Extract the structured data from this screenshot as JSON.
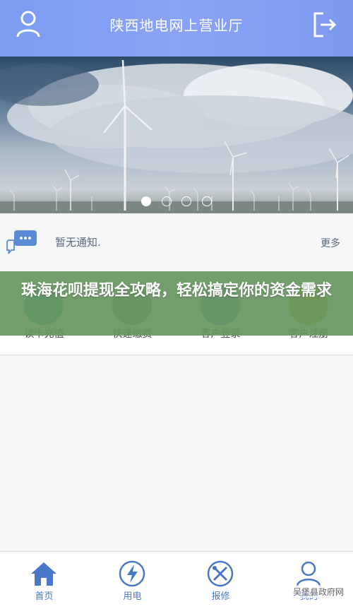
{
  "header": {
    "title": "陕西地电网上营业厅",
    "user_icon": "user-icon",
    "logout_icon": "logout-icon"
  },
  "banner": {
    "slide_count": 4,
    "active_slide": 1
  },
  "notice": {
    "icon": "chat-bubble-icon",
    "text": "暂无通知.",
    "more_label": "更多"
  },
  "menu": {
    "items": [
      {
        "label": "读卡充值",
        "color": "#2ba38a"
      },
      {
        "label": "快速缴费",
        "color": "#7a7a7a"
      },
      {
        "label": "客户登录",
        "color": "#5b8ad6"
      },
      {
        "label": "客户注册",
        "color": "#c7b21a"
      }
    ]
  },
  "overlay": {
    "headline": "珠海花呗提现全攻略，轻松搞定你的资金需求"
  },
  "tabbar": {
    "items": [
      {
        "label": "首页",
        "icon": "home-icon"
      },
      {
        "label": "用电",
        "icon": "lightning-icon"
      },
      {
        "label": "报修",
        "icon": "repair-tools-icon"
      },
      {
        "label": "我的",
        "icon": "profile-icon"
      }
    ]
  },
  "watermark": {
    "text": "吴堡县政府网"
  },
  "colors": {
    "header_bg": "#8aa3f5",
    "accent": "#4a78c8",
    "overlay_bg": "#689662"
  }
}
